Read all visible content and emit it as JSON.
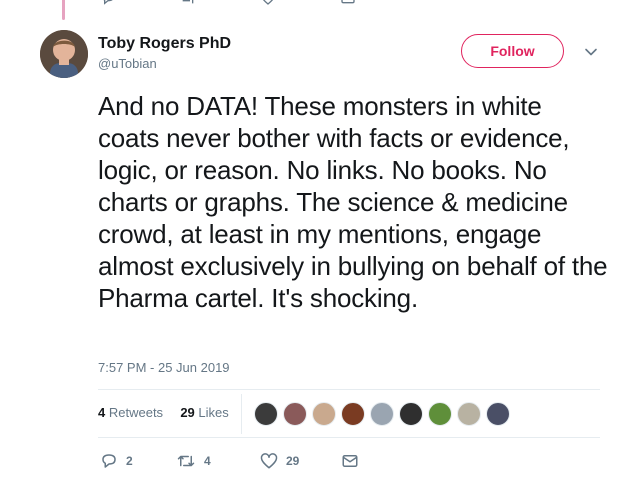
{
  "tweet": {
    "author_name": "Toby Rogers PhD",
    "author_handle": "@uTobian",
    "follow_label": "Follow",
    "text": "And no DATA! These monsters in white coats never bother with facts or evidence, logic, or reason. No links. No books. No charts or graphs. The science & medicine crowd, at least in my mentions, engage almost exclusively in bullying on behalf of the Pharma cartel. It's shocking.",
    "timestamp": "7:57 PM - 25 Jun 2019"
  },
  "stats": {
    "retweets_count": "4",
    "retweets_label": "Retweets",
    "likes_count": "29",
    "likes_label": "Likes"
  },
  "likers": [
    {
      "icon": "avatar-1",
      "color": "#3b3b3b"
    },
    {
      "icon": "avatar-2",
      "color": "#8a5a5a"
    },
    {
      "icon": "avatar-3",
      "color": "#c9a98e"
    },
    {
      "icon": "avatar-4",
      "color": "#7a3b22"
    },
    {
      "icon": "avatar-5",
      "color": "#9aa5b1"
    },
    {
      "icon": "avatar-6",
      "color": "#2f2f2f"
    },
    {
      "icon": "avatar-7",
      "color": "#5f8f3a"
    },
    {
      "icon": "avatar-8",
      "color": "#b8b2a2"
    },
    {
      "icon": "avatar-9",
      "color": "#4a4f66"
    }
  ],
  "actions": {
    "reply_count": "2",
    "retweet_count": "4",
    "like_count": "29"
  },
  "colors": {
    "accent": "#e0245e",
    "muted": "#657786",
    "divider": "#e6ecf0",
    "text": "#14171a"
  }
}
